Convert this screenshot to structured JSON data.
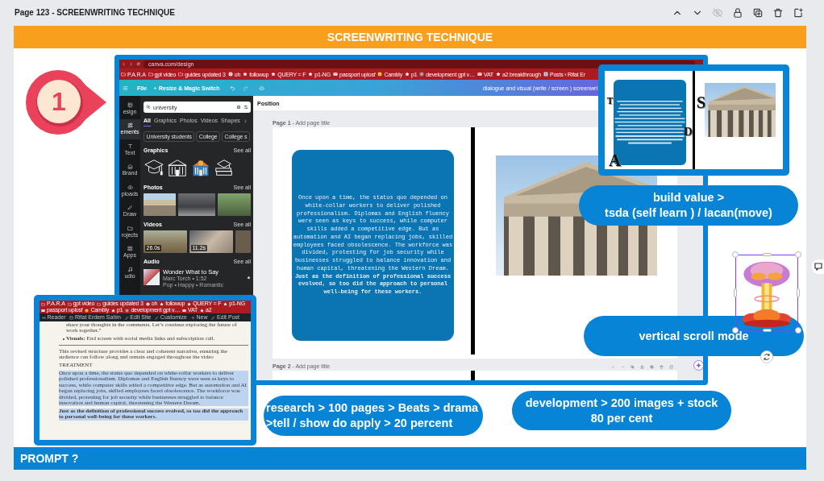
{
  "page_bar": {
    "title": "Page 123 - SCREENWRITING TECHNIQUE",
    "actions": [
      {
        "kind": "up",
        "disabled": false
      },
      {
        "kind": "down",
        "disabled": false
      },
      {
        "kind": "hide",
        "disabled": true
      },
      {
        "kind": "lock",
        "disabled": false
      },
      {
        "kind": "duplicate",
        "disabled": false
      },
      {
        "kind": "delete",
        "disabled": false
      },
      {
        "kind": "add",
        "disabled": false
      }
    ]
  },
  "slide": {
    "title": "SCREENWRITING TECHNIQUE",
    "step_marker": "1",
    "footer": "PROMPT ?"
  },
  "canva_screenshot": {
    "address": "canva.com/design",
    "bookmarks": [
      {
        "kind": "folder",
        "label": "P.A.R.A"
      },
      {
        "kind": "folder",
        "label": "gpt video"
      },
      {
        "kind": "folder",
        "label": "guides updated 3"
      },
      {
        "kind": "globe",
        "label": "oh"
      },
      {
        "kind": "star",
        "label": "followup"
      },
      {
        "kind": "star",
        "label": "QUERY = F"
      },
      {
        "kind": "star",
        "label": "p1-NG"
      },
      {
        "kind": "mail",
        "label": "passport uplosf"
      },
      {
        "kind": "emoji",
        "label": "Cambly"
      },
      {
        "kind": "star",
        "label": "p1"
      },
      {
        "kind": "app",
        "label": "development gpt v…"
      },
      {
        "kind": "mail",
        "label": "VAT"
      },
      {
        "kind": "star",
        "label": "a2 breakthrough"
      },
      {
        "kind": "avatar",
        "label": "Posts ‹ Rifat Er"
      }
    ],
    "toolbar": {
      "menu": [
        {
          "kind": "plain",
          "label": "File"
        },
        {
          "kind": "magic",
          "label": "Resize & Magic Switch"
        }
      ],
      "document_title": "dialogue and visual (write / screen ) screenwri"
    },
    "rail": [
      {
        "kind": "design",
        "label": "esign",
        "selected": false
      },
      {
        "kind": "elements",
        "label": "ements",
        "selected": true
      },
      {
        "kind": "text",
        "label": "Text",
        "selected": false
      },
      {
        "kind": "brand",
        "label": "Brand",
        "selected": false
      },
      {
        "kind": "uploads",
        "label": "ploads",
        "selected": false
      },
      {
        "kind": "draw",
        "label": "Draw",
        "selected": false
      },
      {
        "kind": "projects",
        "label": "rojects",
        "selected": false
      },
      {
        "kind": "apps",
        "label": "Apps",
        "selected": false
      },
      {
        "kind": "audio",
        "label": "udio",
        "selected": false
      }
    ],
    "panel": {
      "search": "university",
      "tabs": [
        {
          "label": "All",
          "selected": true
        },
        {
          "label": "Graphics",
          "selected": false
        },
        {
          "label": "Photos",
          "selected": false
        },
        {
          "label": "Videos",
          "selected": false
        },
        {
          "label": "Shapes",
          "selected": false
        }
      ],
      "chips": [
        "University students",
        "College",
        "College s"
      ],
      "sections": [
        {
          "kind": "graphics",
          "title": "Graphics",
          "link": "See all"
        },
        {
          "kind": "photos",
          "title": "Photos",
          "link": "See all"
        },
        {
          "kind": "videos",
          "title": "Videos",
          "link": "See all",
          "durations": [
            "26.0s",
            "11.2s"
          ]
        },
        {
          "kind": "audio",
          "title": "Audio",
          "link": "See all",
          "track": {
            "title": "Wonder What to Say",
            "artist": "Marc Torch • 1:52",
            "tags": "Pop • Happy • Romantic"
          }
        }
      ]
    },
    "canvas": {
      "header": "Position",
      "pages": [
        {
          "label": "**Page 1** - Add page title"
        },
        {
          "label": "**Page 2** - Add page title"
        }
      ],
      "card_text": "Once upon a time, the status quo depended on white-collar workers to deliver polished professionalism. Diplomas and English fluency were seen as keys to success, while computer skills added a competitive edge. But as automation and AI began replacing jobs, skilled employees faced obsolescence. The workforce was divided, protesting for job security while businesses struggled to balance innovation and human capital, threatening the Western Dream. **Just as the definition of professional success evolved, so too did the approach to personal well-being for these workers.**"
    }
  },
  "design_inset": {
    "letters": [
      "T",
      "S",
      "D",
      "A"
    ]
  },
  "callouts": [
    {
      "lines": [
        "build value >",
        "tsda (self learn ) / lacan(move)"
      ]
    },
    {
      "lines": [
        "vertical scroll mode"
      ]
    },
    {
      "lines": [
        "research > 100 pages > Beats > drama",
        ">tell / show do apply > 20 percent"
      ]
    },
    {
      "lines": [
        "development > 200 images + stock",
        "80 per cent"
      ]
    }
  ],
  "sticker": {
    "selected": true
  },
  "doc_inset": {
    "bookmarks": [
      {
        "kind": "folder",
        "label": "P.A.R.A"
      },
      {
        "kind": "folder",
        "label": "gpt video"
      },
      {
        "kind": "folder",
        "label": "guides updated 3"
      },
      {
        "kind": "globe",
        "label": "oh"
      },
      {
        "kind": "star",
        "label": "followup"
      },
      {
        "kind": "star",
        "label": "QUERY = F"
      },
      {
        "kind": "star",
        "label": "p1-NG"
      },
      {
        "kind": "mail",
        "label": "passport uplosf"
      },
      {
        "kind": "emoji",
        "label": "Cambly"
      },
      {
        "kind": "star",
        "label": "p1"
      },
      {
        "kind": "app",
        "label": "development gpt v…"
      },
      {
        "kind": "mail",
        "label": "VAT"
      },
      {
        "kind": "star",
        "label": "a2"
      }
    ],
    "admin_bar": [
      {
        "kind": "reader",
        "label": "Reader"
      },
      {
        "kind": "site",
        "label": "Rifat Erdem Sahin"
      },
      {
        "kind": "edit",
        "label": "Edit Site"
      },
      {
        "kind": "customize",
        "label": "Customize"
      },
      {
        "kind": "new",
        "label": "New"
      },
      {
        "kind": "edit",
        "label": "Edit Post"
      }
    ],
    "blocks": [
      {
        "kind": "indent",
        "text": "share your thoughts in the comments. Let’s continue exploring the future of work together.”",
        "highlighted": false
      },
      {
        "kind": "bullet",
        "text": "**Visuals:** End screen with social media links and subscription call.",
        "highlighted": false
      },
      {
        "kind": "rule"
      },
      {
        "kind": "text",
        "text": "This revised structure provides a clear and coherent narrative, ensuring the audience can follow along and remain engaged throughout the video",
        "highlighted": false
      },
      {
        "kind": "text",
        "text": "TREATMENT",
        "highlighted": false
      },
      {
        "kind": "text",
        "text": "Once upon a time, the status quo depended on white-collar workers to deliver polished professionalism. Diplomas and English fluency were seen as keys to success, while computer skills added a competitive edge. But as automation and AI began replacing jobs, skilled employees faced obsolescence. The workforce was divided, protesting for job security while businesses struggled to balance innovation and human capital, threatening the Western Dream.",
        "highlighted": true
      },
      {
        "kind": "strong",
        "text": "Just as the definition of professional success evolved, so too did the approach to personal well-being for these workers.",
        "highlighted": true
      }
    ]
  }
}
